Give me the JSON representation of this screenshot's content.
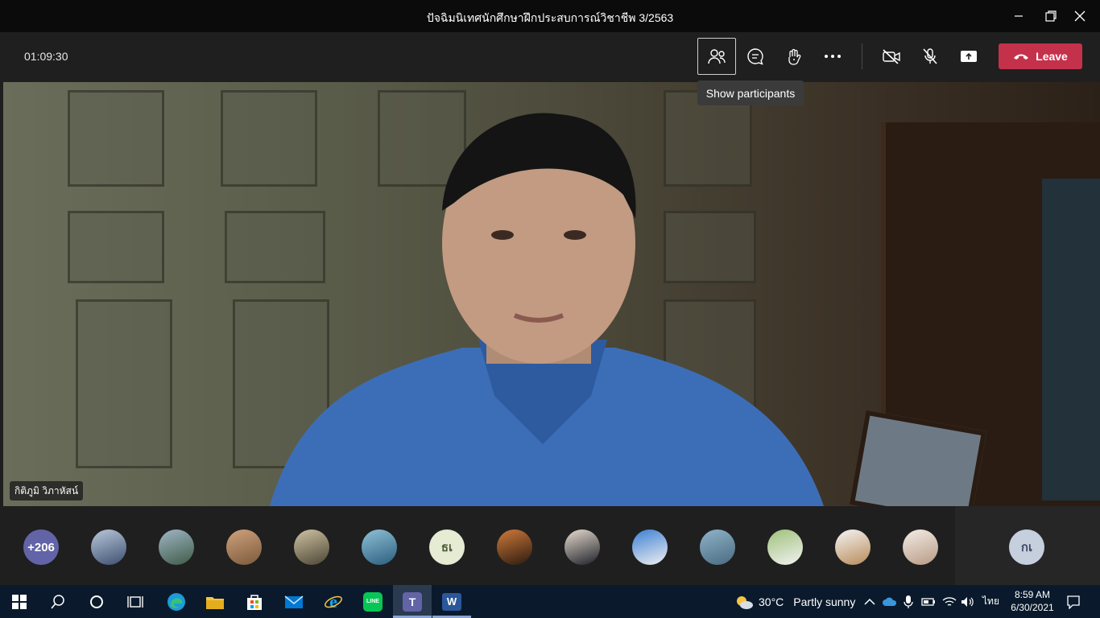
{
  "window": {
    "title": "ปัจฉิมนิเทศนักศึกษาฝึกประสบการณ์วิชาชีพ 3/2563"
  },
  "call": {
    "timer": "01:09:30",
    "leave_label": "Leave",
    "tooltip": "Show participants"
  },
  "video": {
    "speaker_name": "กิติภูมิ วิภาหัสน์"
  },
  "strip": {
    "overflow_count": "+206",
    "avatar_initials_1": "ธเ",
    "avatar_initials_2": "กเ"
  },
  "taskbar": {
    "weather_temp": "30°C",
    "weather_text": "Partly sunny",
    "lang": "ไทย",
    "time": "8:59 AM",
    "date": "6/30/2021",
    "line_label": "LINE",
    "teams_label": "T",
    "word_label": "W"
  },
  "colors": {
    "leave_red": "#c4314b",
    "teams_purple": "#6264a7",
    "taskbar_bg": "#0a1a2c"
  }
}
